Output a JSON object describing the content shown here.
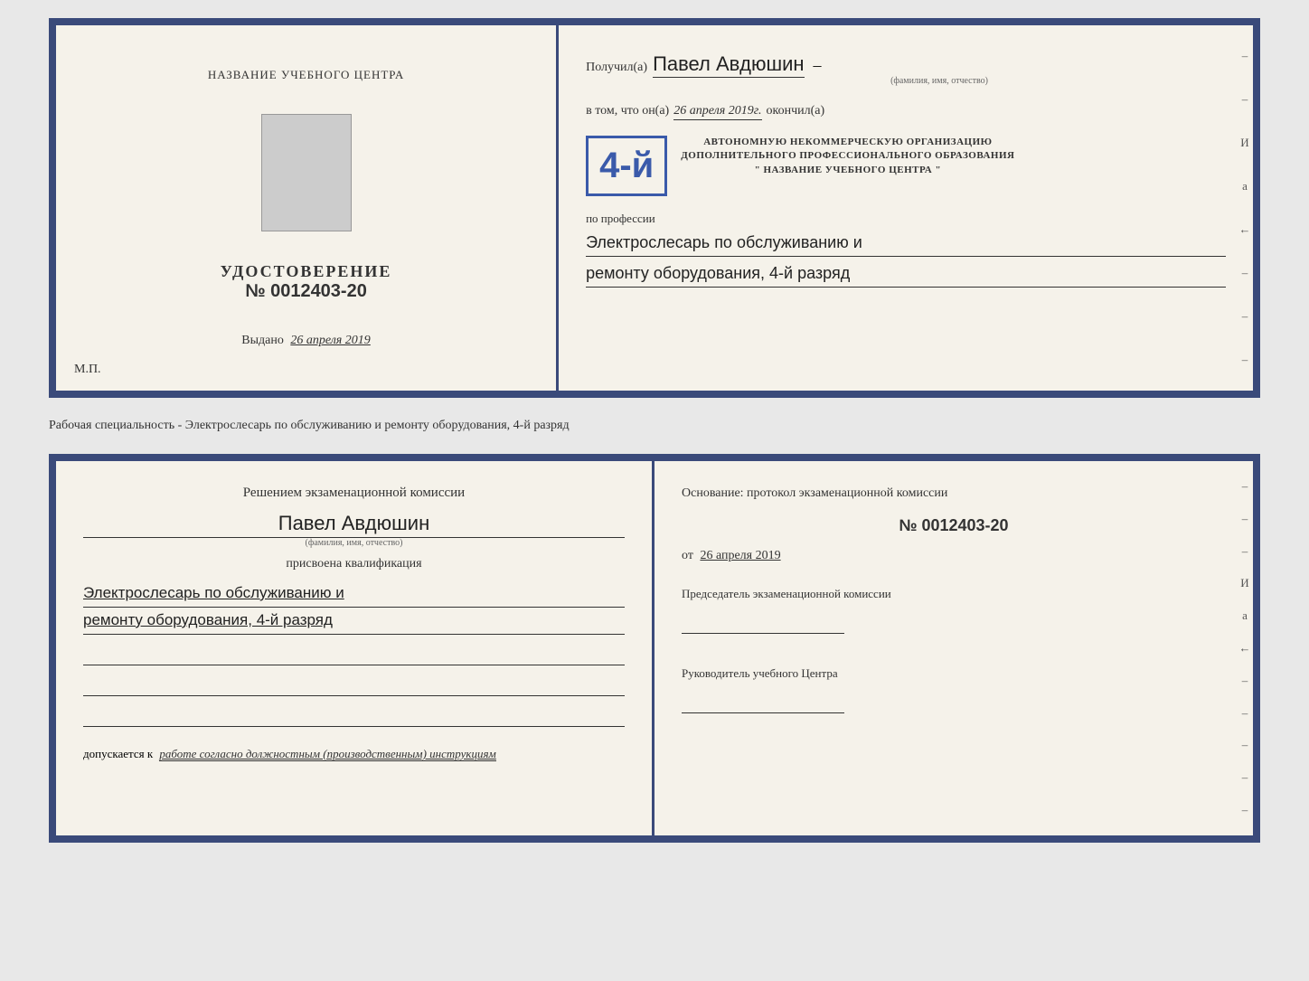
{
  "top_doc": {
    "left": {
      "center_title": "НАЗВАНИЕ УЧЕБНОГО ЦЕНТРА",
      "cert_title": "УДОСТОВЕРЕНИЕ",
      "cert_number": "№ 0012403-20",
      "issued_label": "Выдано",
      "issued_date": "26 апреля 2019",
      "mp_label": "М.П."
    },
    "right": {
      "recipient_label": "Получил(а)",
      "recipient_name": "Павел Авдюшин",
      "fio_small": "(фамилия, имя, отчество)",
      "dash": "–",
      "vtom_text": "в том, что он(а)",
      "completed_date": "26 апреля 2019г.",
      "okonchil": "окончил(а)",
      "stamp_grade": "4-й",
      "stamp_line1": "АВТОНОМНУЮ НЕКОММЕРЧЕСКУЮ ОРГАНИЗАЦИЮ",
      "stamp_line2": "ДОПОЛНИТЕЛЬНОГО ПРОФЕССИОНАЛЬНОГО ОБРАЗОВАНИЯ",
      "stamp_line3": "\" НАЗВАНИЕ УЧЕБНОГО ЦЕНТРА \"",
      "po_professii": "по профессии",
      "profession_line1": "Электрослесарь по обслуживанию и",
      "profession_line2": "ремонту оборудования, 4-й разряд"
    }
  },
  "separator": {
    "text": "Рабочая специальность - Электрослесарь по обслуживанию и ремонту оборудования, 4-й разряд"
  },
  "bottom_doc": {
    "left": {
      "commission_title": "Решением экзаменационной комиссии",
      "person_name": "Павел Авдюшин",
      "fio_small": "(фамилия, имя, отчество)",
      "prisvoena": "присвоена квалификация",
      "qual_line1": "Электрослесарь по обслуживанию и",
      "qual_line2": "ремонту оборудования, 4-й разряд",
      "допускается_label": "допускается к",
      "допускается_value": "работе согласно должностным (производственным) инструкциям"
    },
    "right": {
      "osnov_title": "Основание: протокол экзаменационной комиссии",
      "osnov_number": "№ 0012403-20",
      "ot_label": "от",
      "ot_date": "26 апреля 2019",
      "predsed_label": "Председатель экзаменационной комиссии",
      "ruk_label": "Руководитель учебного Центра"
    },
    "right_margin_chars": [
      "–",
      "–",
      "–",
      "И",
      "а",
      "←",
      "–",
      "–",
      "–",
      "–",
      "–"
    ]
  }
}
